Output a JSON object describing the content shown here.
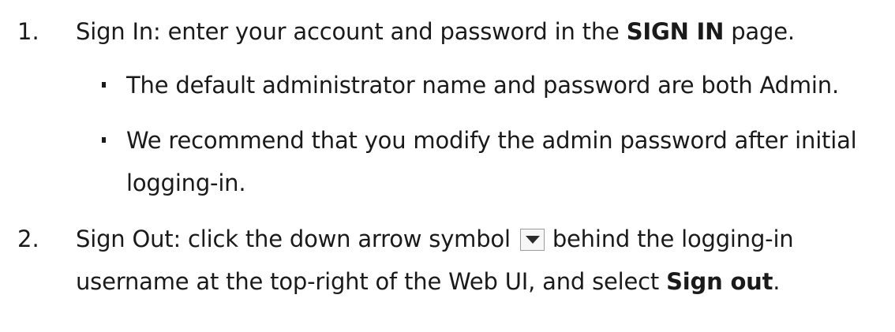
{
  "steps": [
    {
      "number": "1.",
      "prefix": "Sign In: enter your account and password in the ",
      "bold": "SIGN IN",
      "suffix": " page.",
      "bullets": [
        {
          "line1": "The default administrator name and password are both Admin."
        },
        {
          "line1": "We recommend that you modify the admin password after initial",
          "line2": "logging-in."
        }
      ]
    },
    {
      "number": "2.",
      "prefix": "Sign Out: click the down arrow symbol",
      "after_icon": "behind the logging-in",
      "line2_prefix": "username at the top-right of the Web UI, and select ",
      "line2_bold": "Sign out",
      "line2_suffix": ".",
      "icon": "dropdown-arrow-icon"
    }
  ]
}
